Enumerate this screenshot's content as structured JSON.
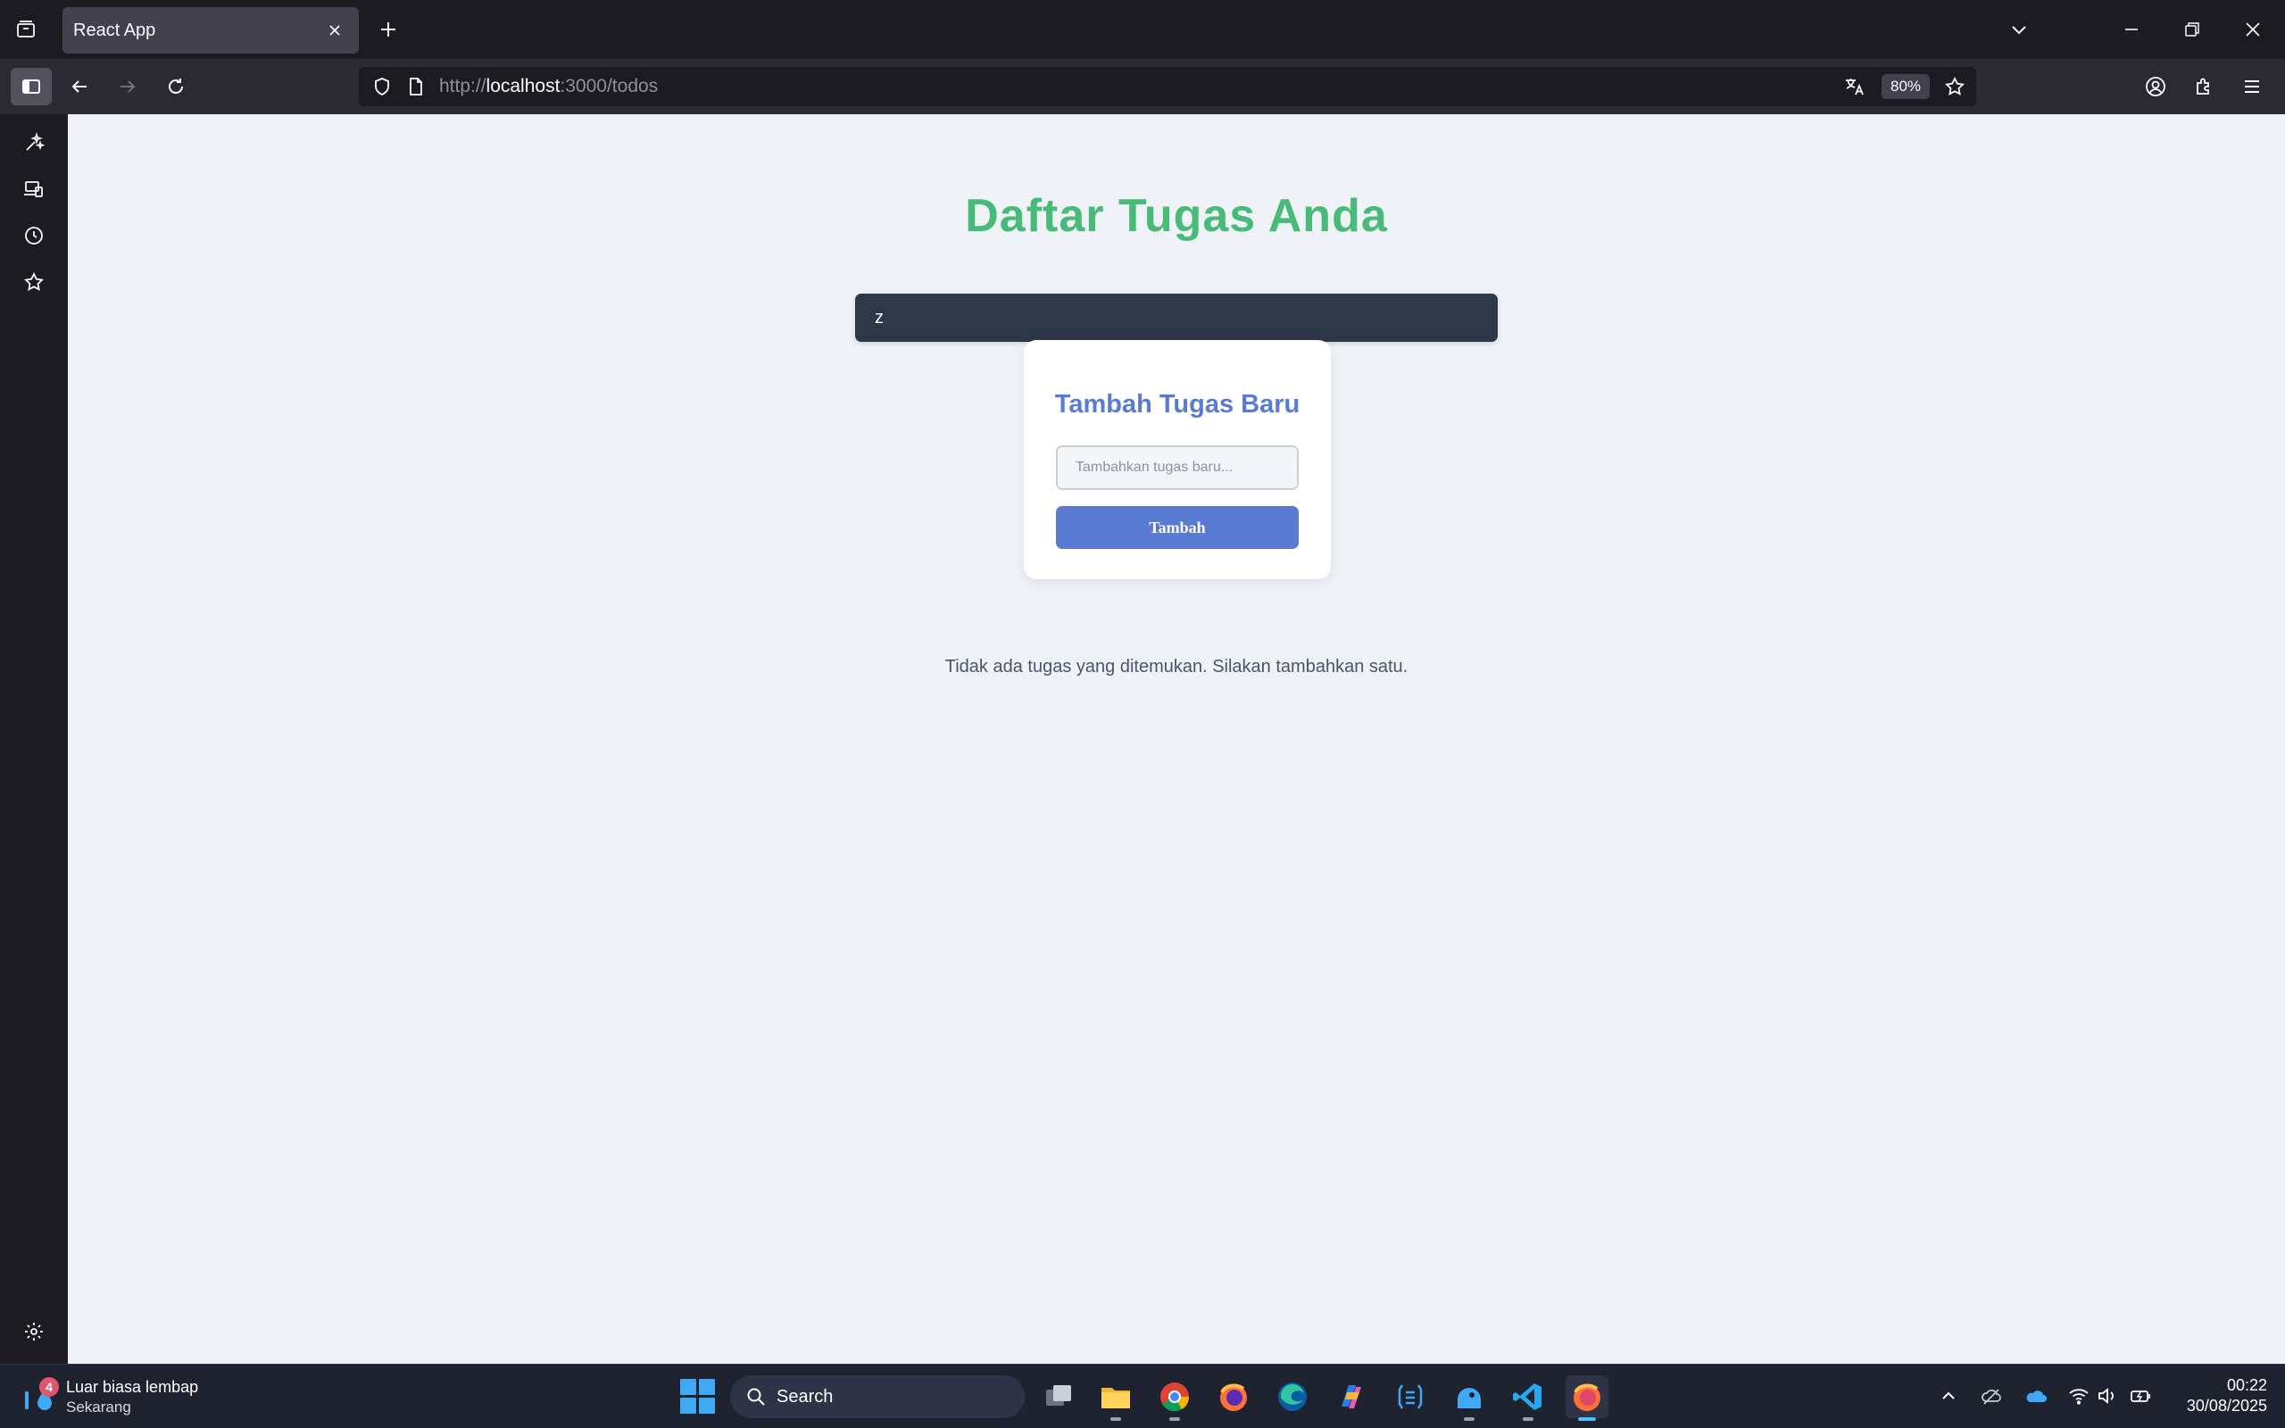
{
  "browser": {
    "tab_title": "React App",
    "url_prefix": "http://",
    "url_host": "localhost",
    "url_rest": ":3000/todos",
    "zoom": "80%"
  },
  "page": {
    "title": "Daftar Tugas Anda",
    "search_value": "z",
    "card": {
      "title": "Tambah Tugas Baru",
      "input_placeholder": "Tambahkan tugas baru...",
      "button_label": "Tambah"
    },
    "empty_message": "Tidak ada tugas yang ditemukan. Silakan tambahkan satu."
  },
  "taskbar": {
    "weather_title": "Luar biasa lembap",
    "weather_subtitle": "Sekarang",
    "weather_badge": "4",
    "search_label": "Search",
    "time": "00:22",
    "date": "30/08/2025",
    "apps": [
      "task-view",
      "file-explorer",
      "chrome",
      "firefox",
      "edge",
      "copilot",
      "wsl-terminal",
      "fluent-app",
      "vscode",
      "firefox-developer"
    ]
  },
  "colors": {
    "title_green": "#48bb78",
    "accent_blue": "#5a7bd4",
    "search_dark": "#2d3748",
    "page_bg": "#eff2f6"
  }
}
